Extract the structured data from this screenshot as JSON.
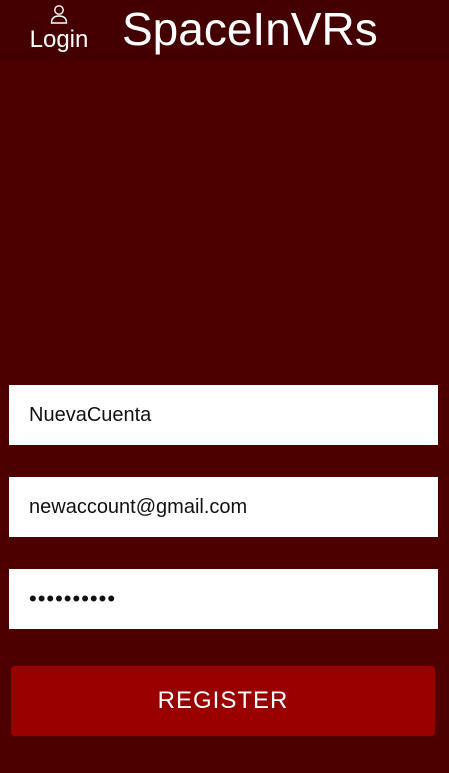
{
  "header": {
    "login_icon": "user-icon",
    "login_label": "Login",
    "app_title": "SpaceInVRs"
  },
  "form": {
    "username": {
      "value": "NuevaCuenta",
      "placeholder": ""
    },
    "email": {
      "value": "newaccount@gmail.com",
      "placeholder": ""
    },
    "password": {
      "value": "••••••••••",
      "placeholder": ""
    },
    "register_label": "REGISTER"
  },
  "colors": {
    "background": "#4d0000",
    "header_background": "#440000",
    "button": "#990000",
    "text": "#ffffff"
  }
}
